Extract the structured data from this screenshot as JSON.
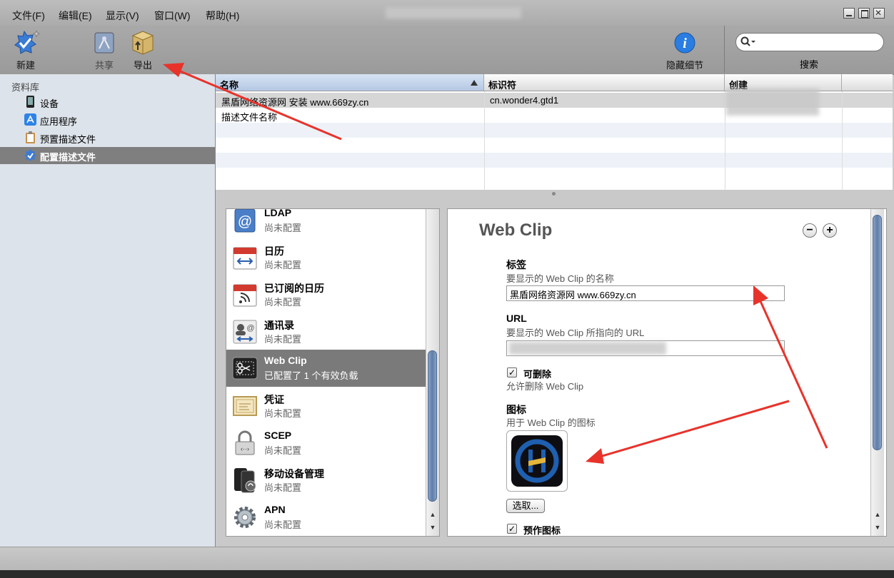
{
  "menubar": {
    "items": [
      "文件(F)",
      "编辑(E)",
      "显示(V)",
      "窗口(W)",
      "帮助(H)"
    ]
  },
  "toolbar": {
    "new_label": "新建",
    "share_label": "共享",
    "export_label": "导出",
    "hide_details_label": "隐藏细节",
    "search_label": "搜索",
    "search_value": ""
  },
  "sidebar": {
    "header": "资料库",
    "items": [
      {
        "label": "设备",
        "icon": "phone-icon"
      },
      {
        "label": "应用程序",
        "icon": "app-store-icon"
      },
      {
        "label": "预置描述文件",
        "icon": "clipboard-icon"
      },
      {
        "label": "配置描述文件",
        "icon": "checkmark-badge-icon",
        "selected": true
      }
    ]
  },
  "table": {
    "columns": [
      "名称",
      "标识符",
      "创建"
    ],
    "rows": [
      {
        "name": "黑盾网络资源网 安装  www.669zy.cn",
        "identifier": "cn.wonder4.gtd1",
        "created": ""
      },
      {
        "name": "描述文件名称",
        "identifier": "",
        "created": ""
      }
    ]
  },
  "payloads": [
    {
      "name": "LDAP",
      "status": "尚未配置",
      "icon": "ldap-at-icon"
    },
    {
      "name": "日历",
      "status": "尚未配置",
      "icon": "calendar-icon"
    },
    {
      "name": "已订阅的日历",
      "status": "尚未配置",
      "icon": "subscribed-calendar-icon"
    },
    {
      "name": "通讯录",
      "status": "尚未配置",
      "icon": "contacts-icon"
    },
    {
      "name": "Web Clip",
      "status": "已配置了 1 个有效负载",
      "icon": "scissors-icon",
      "selected": true
    },
    {
      "name": "凭证",
      "status": "尚未配置",
      "icon": "certificate-icon"
    },
    {
      "name": "SCEP",
      "status": "尚未配置",
      "icon": "lock-icon"
    },
    {
      "name": "移动设备管理",
      "status": "尚未配置",
      "icon": "mdm-icon"
    },
    {
      "name": "APN",
      "status": "尚未配置",
      "icon": "gear-icon"
    }
  ],
  "detail": {
    "title": "Web Clip",
    "label_title": "标签",
    "label_desc": "要显示的 Web Clip 的名称",
    "label_value": "黑盾网络资源网 www.669zy.cn",
    "url_title": "URL",
    "url_desc": "要显示的 Web Clip 所指向的 URL",
    "url_value": "",
    "removable_title": "可删除",
    "removable_desc": "允许删除 Web Clip",
    "removable_checked": true,
    "icon_title": "图标",
    "icon_desc": "用于 Web Clip 的图标",
    "choose_label": "选取...",
    "precomposed_title": "预作图标",
    "precomposed_checked": true,
    "minus_label": "−",
    "plus_label": "+"
  },
  "colors": {
    "selection": "#7a7a7a",
    "annotation": "#e8332b",
    "scroll_thumb": "#6b88b1"
  }
}
